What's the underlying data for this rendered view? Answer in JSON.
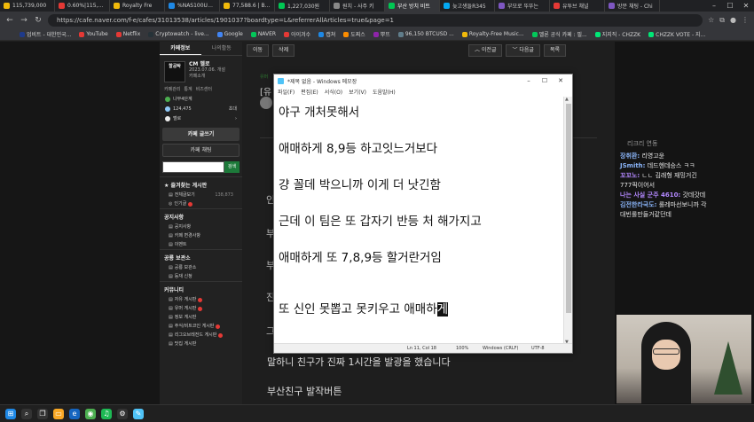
{
  "browser": {
    "tabs": [
      {
        "label": "115,739,000",
        "color": "#f0b90b",
        "active": false
      },
      {
        "label": "0.60%|115,739",
        "color": "#e53935",
        "active": false
      },
      {
        "label": "Royalty Fre",
        "color": "#f0b90b",
        "active": false
      },
      {
        "label": "%NAS100USD 2",
        "color": "#1e88e5",
        "active": false
      },
      {
        "label": "77,588.6 | BTCU",
        "color": "#f0b90b",
        "active": false
      },
      {
        "label": "1,227,030원",
        "color": "#00c853",
        "active": false
      },
      {
        "label": "원치 - 사주 키",
        "color": "#888888",
        "active": false
      },
      {
        "label": "부산 방치 비트",
        "color": "#00c853",
        "active": true
      },
      {
        "label": "늦고생들R345",
        "color": "#03a9f4",
        "active": false
      },
      {
        "label": "부모로 뚜뚜는",
        "color": "#7e57c2",
        "active": false
      },
      {
        "label": "유투브 채널",
        "color": "#e53935",
        "active": false
      },
      {
        "label": "방문 채팅 - Chi",
        "color": "#7e57c2",
        "active": false
      }
    ],
    "url": "https://cafe.naver.com/f-e/cafes/31013538/articles/1901037?boardtype=L&referrerAllArticles=true&page=1",
    "bookmarks": [
      {
        "label": "업비트 - 대한민국...",
        "color": "#1e3a8a"
      },
      {
        "label": "YouTube",
        "color": "#e53935"
      },
      {
        "label": "Netflix",
        "color": "#e53935"
      },
      {
        "label": "Cryptowatch - live...",
        "color": "#263238"
      },
      {
        "label": "Google",
        "color": "#4285f4"
      },
      {
        "label": "NAVER",
        "color": "#03c75a"
      },
      {
        "label": "아이겨수",
        "color": "#e53935"
      },
      {
        "label": "캡쳐",
        "color": "#1e88e5"
      },
      {
        "label": "도찌스",
        "color": "#fb8c00"
      },
      {
        "label": "뿌뜨",
        "color": "#8e24aa"
      },
      {
        "label": "96,150 BTCUSD ...",
        "color": "#607d8b"
      },
      {
        "label": "Royalty-Free Music...",
        "color": "#f0b90b"
      },
      {
        "label": "멜론 공식 카페 : 필...",
        "color": "#03c75a"
      },
      {
        "label": "지지직 - CHZZK",
        "color": "#00e676"
      },
      {
        "label": "CHZZK VOTE - 지...",
        "color": "#00e676"
      }
    ]
  },
  "cafe_sidebar": {
    "tab_info": "카페정보",
    "tab_activity": "나의활동",
    "logo_text": "할공탁",
    "cafe_name": "CM 멜로",
    "cafe_sub1": "2023.07.06. 개설",
    "cafe_sub2": "카페소개",
    "link1": "카페관리",
    "link2": "통계",
    "link3": "비즈센터",
    "level": "나무4단계",
    "members_label": "124,475",
    "members_action": "초대",
    "favorite": "멜로",
    "write_button": "카페 글쓰기",
    "chat_button": "카페 채팅",
    "search_button": "검색",
    "section_fav": "즐겨찾는 게시판",
    "all_posts": "전체글보기",
    "all_posts_count": "138,873",
    "popular": "인기글",
    "section_notice": "공지사항",
    "notice_items": [
      "공지사항",
      "카페 변경사항",
      "이벤트"
    ],
    "section_boss": "공룡 보관소",
    "boss_items": [
      "공룡 보관소",
      "등재 신청"
    ],
    "section_community": "커뮤니티",
    "community_items": [
      "자유 게시판",
      "유머 게시판",
      "정보 게시판",
      "주식/비트코인 게시판",
      "리그오브레전드 게시판",
      "맛집 게시판"
    ]
  },
  "article": {
    "btn_move": "이동",
    "btn_delete": "삭제",
    "btn_prev": "이전글",
    "btn_next": "다음글",
    "btn_list": "목록",
    "category": "유머",
    "title_fragment": "[유",
    "frag_1": "인",
    "frag_2": "부",
    "frag_3": "부",
    "frag_4": "진",
    "frag_5": "그",
    "line_1": "말하니 친구가 진짜 1시간을 발광을 했습니다",
    "line_2": "부산친구 발작버튼"
  },
  "notepad": {
    "title": "*제목 없음 - Windows 메모장",
    "menu": [
      "파일(F)",
      "편집(E)",
      "서식(O)",
      "보기(V)",
      "도움말(H)"
    ],
    "lines": [
      "야구 개처못해서",
      "애매하게 8,9등 하고잇느거보다",
      "걍 꼴데 박으니까 이게 더 낫긴함",
      "근데 이 팀은 또 갑자기 반등 처 해가지고",
      "애매하게 또 7,8,9등 할거란거임"
    ],
    "last_line_prefix": "또 신인 못뽑고 못키우고 애매하",
    "last_line_selected": "게",
    "status_position": "Ln 11, Col 18",
    "status_zoom": "100%",
    "status_eol": "Windows (CRLF)",
    "status_encoding": "UTF-8"
  },
  "stream_chat": {
    "header": "리크리 연동",
    "messages": [
      {
        "nick": "장취환:",
        "msg": "리영고윤",
        "color": "#8ab4f8"
      },
      {
        "nick": "JSmith:",
        "msg": "데드헨데승스 ㅋㅋ",
        "color": "#8ab4f8"
      },
      {
        "nick": "꼬꼬노:",
        "msg": "ㄴㄴ 김래형 재밍거긴",
        "color": "#b388ff"
      },
      {
        "nick": "",
        "msg": "777픽이어서",
        "color": "#b388ff"
      },
      {
        "nick": "나는 사실 군주 4610:",
        "msg": "갓데갓데",
        "color": "#b388ff"
      },
      {
        "nick": "김전한라국도:",
        "msg": "롤레마선보니까 각",
        "color": "#8ab4f8"
      },
      {
        "nick": "",
        "msg": "대빈롤만들거같던데",
        "color": "#8ab4f8"
      }
    ]
  }
}
